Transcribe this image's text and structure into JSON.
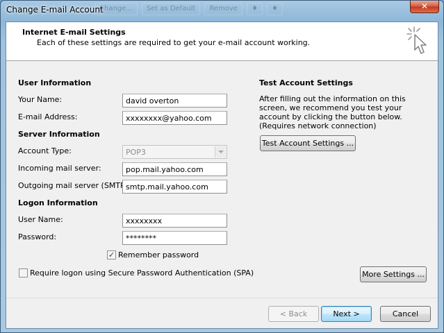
{
  "window": {
    "title": "Change E-mail Account",
    "close_glyph": "✕",
    "background_tabs": [
      "Change...",
      "Set as Default",
      "Remove",
      "♦",
      "♦"
    ]
  },
  "header": {
    "title": "Internet E-mail Settings",
    "subtitle": "Each of these settings are required to get your e-mail account working."
  },
  "user_info": {
    "heading": "User Information",
    "your_name_label": "Your Name:",
    "your_name_value": "david overton",
    "email_label": "E-mail Address:",
    "email_value": "xxxxxxxx@yahoo.com"
  },
  "server_info": {
    "heading": "Server Information",
    "account_type_label": "Account Type:",
    "account_type_value": "POP3",
    "incoming_label": "Incoming mail server:",
    "incoming_value": "pop.mail.yahoo.com",
    "outgoing_label": "Outgoing mail server (SMTP):",
    "outgoing_value": "smtp.mail.yahoo.com"
  },
  "logon_info": {
    "heading": "Logon Information",
    "username_label": "User Name:",
    "username_value": "xxxxxxxx",
    "password_label": "Password:",
    "password_value": "********",
    "remember_label": "Remember password",
    "remember_checked": true,
    "spa_label": "Require logon using Secure Password Authentication (SPA)",
    "spa_checked": false
  },
  "test_settings": {
    "heading": "Test Account Settings",
    "description": "After filling out the information on this screen, we recommend you test your account by clicking the button below. (Requires network connection)",
    "button_label": "Test Account Settings ..."
  },
  "buttons": {
    "more_settings": "More Settings ...",
    "back": "< Back",
    "next": "Next >",
    "cancel": "Cancel"
  },
  "icons": {
    "wizard": "cursor-sparkle-icon",
    "check": "checkmark-icon",
    "dropdown": "chevron-down-icon",
    "close": "close-icon"
  }
}
